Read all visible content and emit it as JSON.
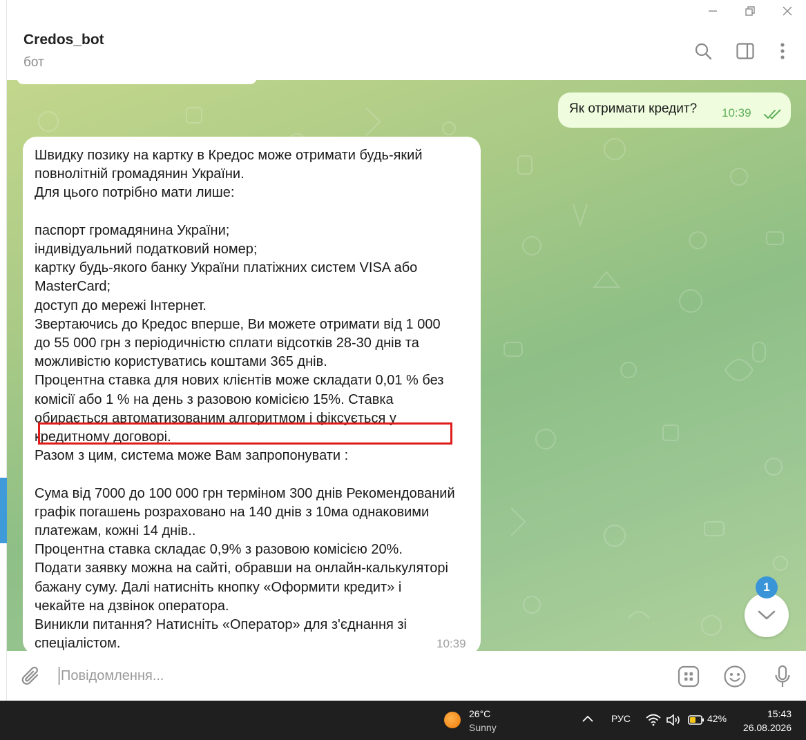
{
  "window": {
    "minimize_icon": "minimize-icon",
    "maximize_icon": "restore-icon",
    "close_icon": "close-icon"
  },
  "header": {
    "title": "Credos_bot",
    "subtitle": "бот",
    "icons": [
      "search-icon",
      "sidebar-toggle-icon",
      "more-vertical-icon"
    ]
  },
  "messages": {
    "outgoing": {
      "text": "Як отримати кредит?",
      "time": "10:39",
      "status": "read"
    },
    "incoming": {
      "text": "Швидку позику на картку в Кредос може отримати будь-який\nповнолітній громадянин України.\nДля цього потрібно мати лише:\n\nпаспорт громадянина України;\nіндивідуальний податковий номер;\nкартку будь-якого банку України платіжних систем VISA або\nMasterCard;\nдоступ до мережі Інтернет.\nЗвертаючись до Кредос вперше, Ви можете отримати від 1 000\nдо 55 000 грн з періодичністю сплати відсотків 28-30 днів та\nможливістю користуватись коштами 365 днів.\nПроцентна ставка для нових клієнтів може складати 0,01 % без\nкомісії або 1 % на день з разовою комісією 15%. Ставка\nобирається автоматизованим алгоритмом і фіксується у\nкредитному договорі.\nРазом з цим, система може Вам запропонувати :\n\nСума від 7000 до 100 000 грн терміном 300 днів Рекомендований\nграфік погашень розраховано на 140 днів з 10ма однаковими\nплатежам, кожні 14 днів..\nПроцентна ставка складає 0,9% з разовою комісією 20%.\nПодати заявку можна на сайті, обравши на онлайн-калькуляторі\nбажану суму. Далі натисніть кнопку «Оформити кредит» і\nчекайте на дзвінок оператора.\nВиникли питання? Натисніть «Оператор» для з'єднання зі\nспеціалістом.",
      "time": "10:39"
    }
  },
  "scroll_down": {
    "unread_count": "1",
    "icon": "chevron-down-icon"
  },
  "composer": {
    "placeholder": "Повідомлення...",
    "value": "",
    "icons": [
      "attach-icon",
      "bot-commands-icon",
      "emoji-icon",
      "microphone-icon"
    ]
  },
  "taskbar": {
    "temperature": "26°C",
    "condition": "Sunny",
    "language": "РУС",
    "battery": "42%",
    "time": "15:43",
    "date": "26.08.2026"
  },
  "colors": {
    "outgoing_bubble": "#effdde",
    "incoming_bubble": "#ffffff",
    "accent": "#3a95d8",
    "highlight": "#e01b1b"
  }
}
